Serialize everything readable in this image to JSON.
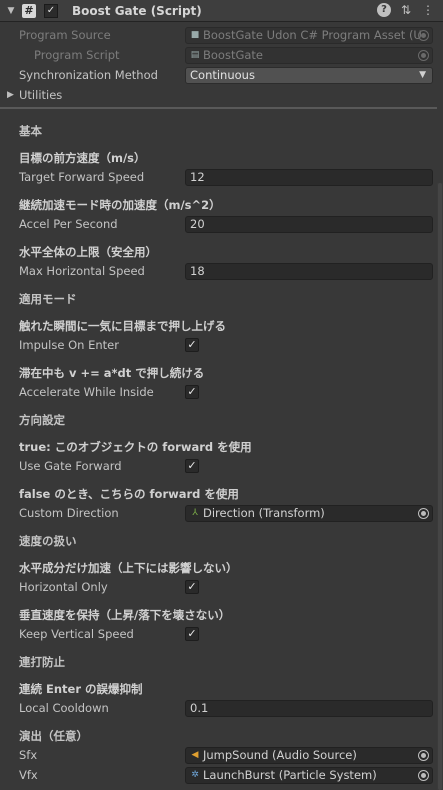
{
  "header": {
    "title": "Boost Gate (Script)",
    "icons": [
      "csharp-script-icon",
      "help-icon",
      "preset-icon",
      "context-menu-icon"
    ]
  },
  "program_source": {
    "label": "Program Source",
    "value": "BoostGate Udon C# Program Asset (U"
  },
  "program_script": {
    "label": "Program Script",
    "value": "BoostGate"
  },
  "sync": {
    "label": "Synchronization Method",
    "value": "Continuous"
  },
  "utilities": {
    "label": "Utilities"
  },
  "sections": {
    "basic": "基本",
    "mode": "適用モード",
    "direction": "方向設定",
    "speed_handling": "速度の扱い",
    "rapid": "連打防止",
    "fx": "演出（任意）"
  },
  "fields": {
    "target_forward_speed": {
      "tooltip": "目標の前方速度（m/s）",
      "label": "Target Forward Speed",
      "value": "12"
    },
    "accel_per_second": {
      "tooltip": "継続加速モード時の加速度（m/s^2）",
      "label": "Accel Per Second",
      "value": "20"
    },
    "max_horizontal_speed": {
      "tooltip": "水平全体の上限（安全用）",
      "label": "Max Horizontal Speed",
      "value": "18"
    },
    "impulse_on_enter": {
      "tooltip": "触れた瞬間に一気に目標まで押し上げる",
      "label": "Impulse On Enter",
      "checked": "✓"
    },
    "accelerate_while_inside": {
      "tooltip": "滞在中も v += a*dt で押し続ける",
      "label": "Accelerate While Inside",
      "checked": "✓"
    },
    "use_gate_forward": {
      "tooltip": "true: このオブジェクトの forward を使用",
      "label": "Use Gate Forward",
      "checked": "✓"
    },
    "custom_direction": {
      "tooltip": "false のとき、こちらの forward を使用",
      "label": "Custom Direction",
      "value": "Direction (Transform)"
    },
    "horizontal_only": {
      "tooltip": "水平成分だけ加速（上下には影響しない）",
      "label": "Horizontal Only",
      "checked": "✓"
    },
    "keep_vertical_speed": {
      "tooltip": "垂直速度を保持（上昇/落下を壊さない）",
      "label": "Keep Vertical Speed",
      "checked": "✓"
    },
    "local_cooldown": {
      "tooltip": "連続 Enter の誤爆抑制",
      "label": "Local Cooldown",
      "value": "0.1"
    },
    "sfx": {
      "label": "Sfx",
      "value": "JumpSound (Audio Source)"
    },
    "vfx": {
      "label": "Vfx",
      "value": "LaunchBurst (Particle System)"
    }
  }
}
